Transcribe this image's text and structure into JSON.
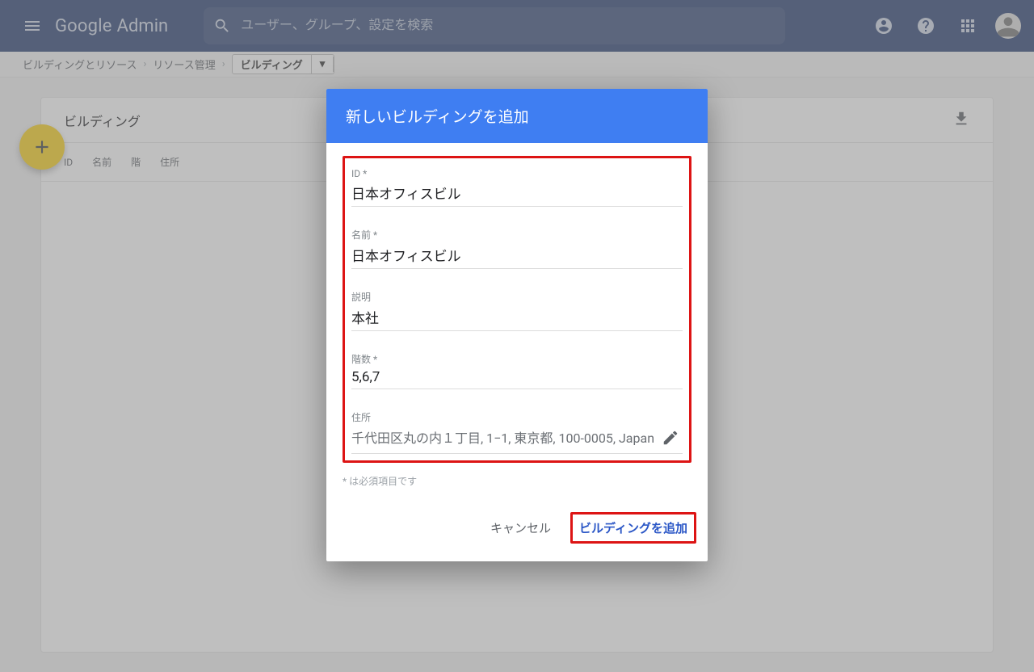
{
  "header": {
    "logo_google": "Google",
    "logo_admin": "Admin",
    "search_placeholder": "ユーザー、グループ、設定を検索"
  },
  "breadcrumb": {
    "item1": "ビルディングとリソース",
    "item2": "リソース管理",
    "current": "ビルディング"
  },
  "card": {
    "title": "ビルディング"
  },
  "columns": {
    "id": "ID",
    "name": "名前",
    "floor": "階",
    "address": "住所"
  },
  "dialog": {
    "title": "新しいビルディングを追加",
    "fields": {
      "id_label": "ID *",
      "id_value": "日本オフィスビル",
      "name_label": "名前 *",
      "name_value": "日本オフィスビル",
      "desc_label": "説明",
      "desc_value": "本社",
      "floors_label": "階数 *",
      "floors_value": "5,6,7",
      "address_label": "住所",
      "address_value": "千代田区丸の内１丁目, 1−1, 東京都, 100-0005, Japan"
    },
    "required_note": "* は必須項目です",
    "actions": {
      "cancel": "キャンセル",
      "submit": "ビルディングを追加"
    }
  }
}
